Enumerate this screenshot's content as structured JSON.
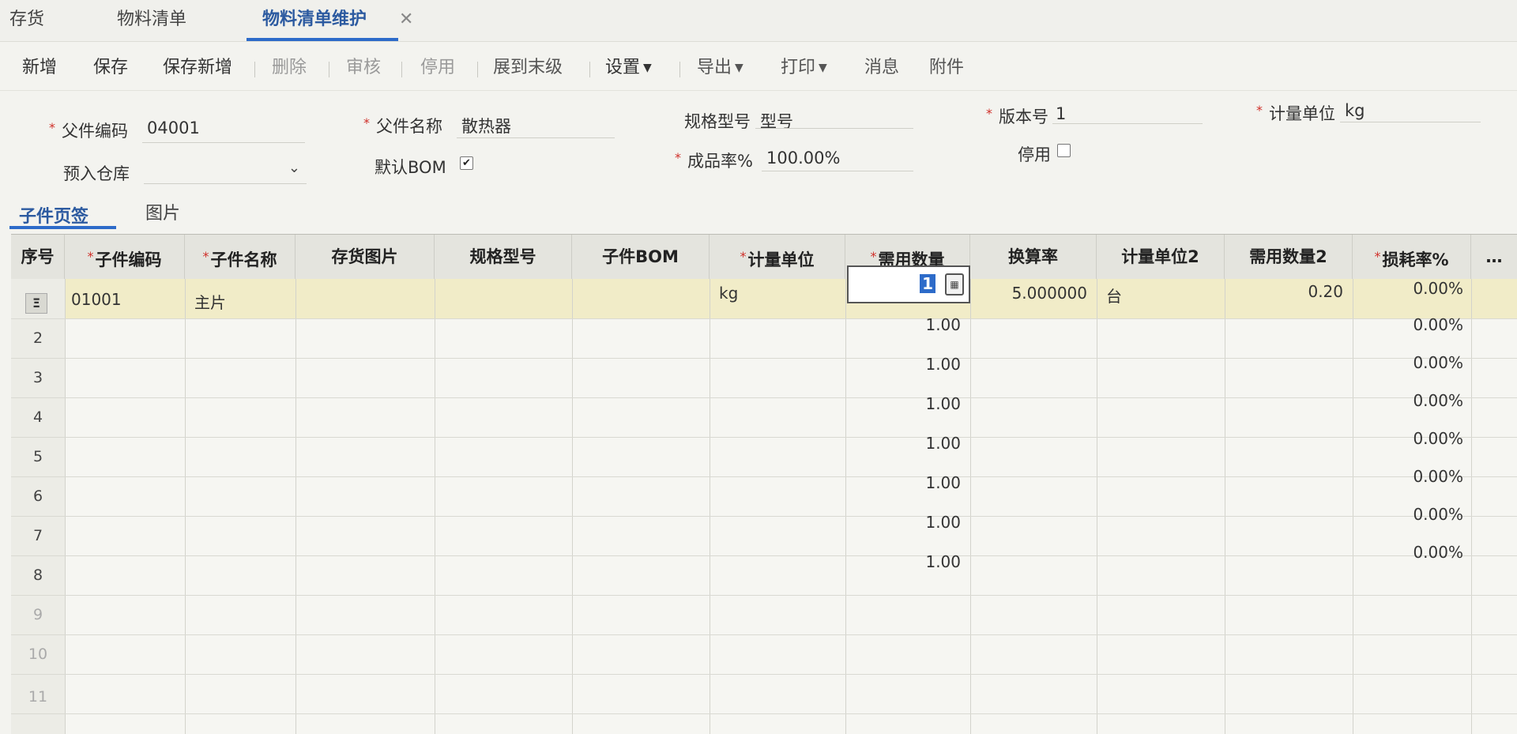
{
  "tabs": [
    {
      "label": "存货"
    },
    {
      "label": "物料清单"
    },
    {
      "label": "物料清单维护"
    }
  ],
  "toolbar": {
    "add": "新增",
    "save": "保存",
    "save_new": "保存新增",
    "delete": "删除",
    "audit": "审核",
    "disable": "停用",
    "expand": "展到末级",
    "settings": "设置",
    "export": "导出",
    "print": "打印",
    "message": "消息",
    "attachment": "附件"
  },
  "form": {
    "parent_code_label": "父件编码",
    "parent_code": "04001",
    "parent_name_label": "父件名称",
    "parent_name": "散热器",
    "spec_label": "规格型号",
    "spec": "型号",
    "version_label": "版本号",
    "version": "1",
    "unit_label": "计量单位",
    "unit": "kg",
    "warehouse_label": "预入仓库",
    "warehouse": "",
    "default_bom_label": "默认BOM",
    "default_bom_checked": true,
    "yield_label": "成品率%",
    "yield": "100.00%",
    "disabled_label": "停用",
    "disabled_checked": false
  },
  "subtabs": [
    {
      "label": "子件页签"
    },
    {
      "label": "图片"
    }
  ],
  "grid": {
    "headers": {
      "seq": "序号",
      "child_code": "子件编码",
      "child_name": "子件名称",
      "image": "存货图片",
      "spec": "规格型号",
      "child_bom": "子件BOM",
      "unit": "计量单位",
      "qty": "需用数量",
      "rate": "换算率",
      "unit2": "计量单位2",
      "qty2": "需用数量2",
      "loss": "损耗率%"
    },
    "row1": {
      "seq_icon": "Ξ",
      "child_code": "01001",
      "child_name": "主片",
      "unit": "kg",
      "qty_editing": "1",
      "rate": "5.000000",
      "unit2": "台",
      "qty2": "0.20",
      "loss": "0.00%"
    },
    "qty_column": [
      "1.00",
      "1.00",
      "1.00",
      "1.00",
      "1.00",
      "1.00",
      "1.00"
    ],
    "loss_column": [
      "0.00%",
      "0.00%",
      "0.00%",
      "0.00%",
      "0.00%",
      "0.00%",
      "0.00%"
    ],
    "row_numbers": [
      "2",
      "3",
      "4",
      "5",
      "6",
      "7",
      "8",
      "9",
      "10",
      "11"
    ]
  },
  "colors": {
    "accent": "#2d6bc9",
    "required": "#d0302a",
    "selected_row": "#f1ecc8"
  }
}
